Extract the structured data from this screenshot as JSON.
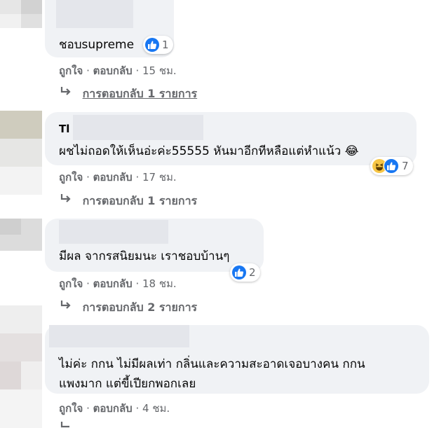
{
  "colors": {
    "bubble": "#f0f2f5",
    "meta": "#65676b",
    "like": "#1877f2",
    "haha": "#f7c646"
  },
  "comments": [
    {
      "author": "",
      "text": "ชอบsupreme",
      "reaction_count": "1",
      "like": "ถูกใจ",
      "reply": "ตอบกลับ",
      "time": "· 15 ชม.",
      "replies_link": "การตอบกลับ 1 รายการ"
    },
    {
      "author": "Tl",
      "text": "ผชไม่ถอดให้เห็นอ่ะค่ะ55555 หันมาอีกทีหลือแต่หำแน้ว 😂",
      "reaction_count": "7",
      "like": "ถูกใจ",
      "reply": "ตอบกลับ",
      "time": "· 17 ชม.",
      "replies_link": "การตอบกลับ 1 รายการ"
    },
    {
      "author": "",
      "text": "มีผล จากรสนิยมนะ เราชอบบ้านๆ",
      "reaction_count": "2",
      "like": "ถูกใจ",
      "reply": "ตอบกลับ",
      "time": "· 18 ชม.",
      "replies_link": "การตอบกลับ 2 รายการ"
    },
    {
      "author": "",
      "text_line1": "ไม่ค่ะ กกน ไม่มีผลเท่า กลิ่นและความสะอาดเจอบางคน กกน",
      "text_line2": "แพงมาก แต่ขี้เปียกพอกเลย",
      "like": "ถูกใจ",
      "reply": "ตอบกลับ",
      "time": "· 4 ชม."
    }
  ],
  "icons": {
    "reply_arrow": "reply-arrow-icon",
    "like": "like-icon",
    "haha": "haha-icon"
  }
}
